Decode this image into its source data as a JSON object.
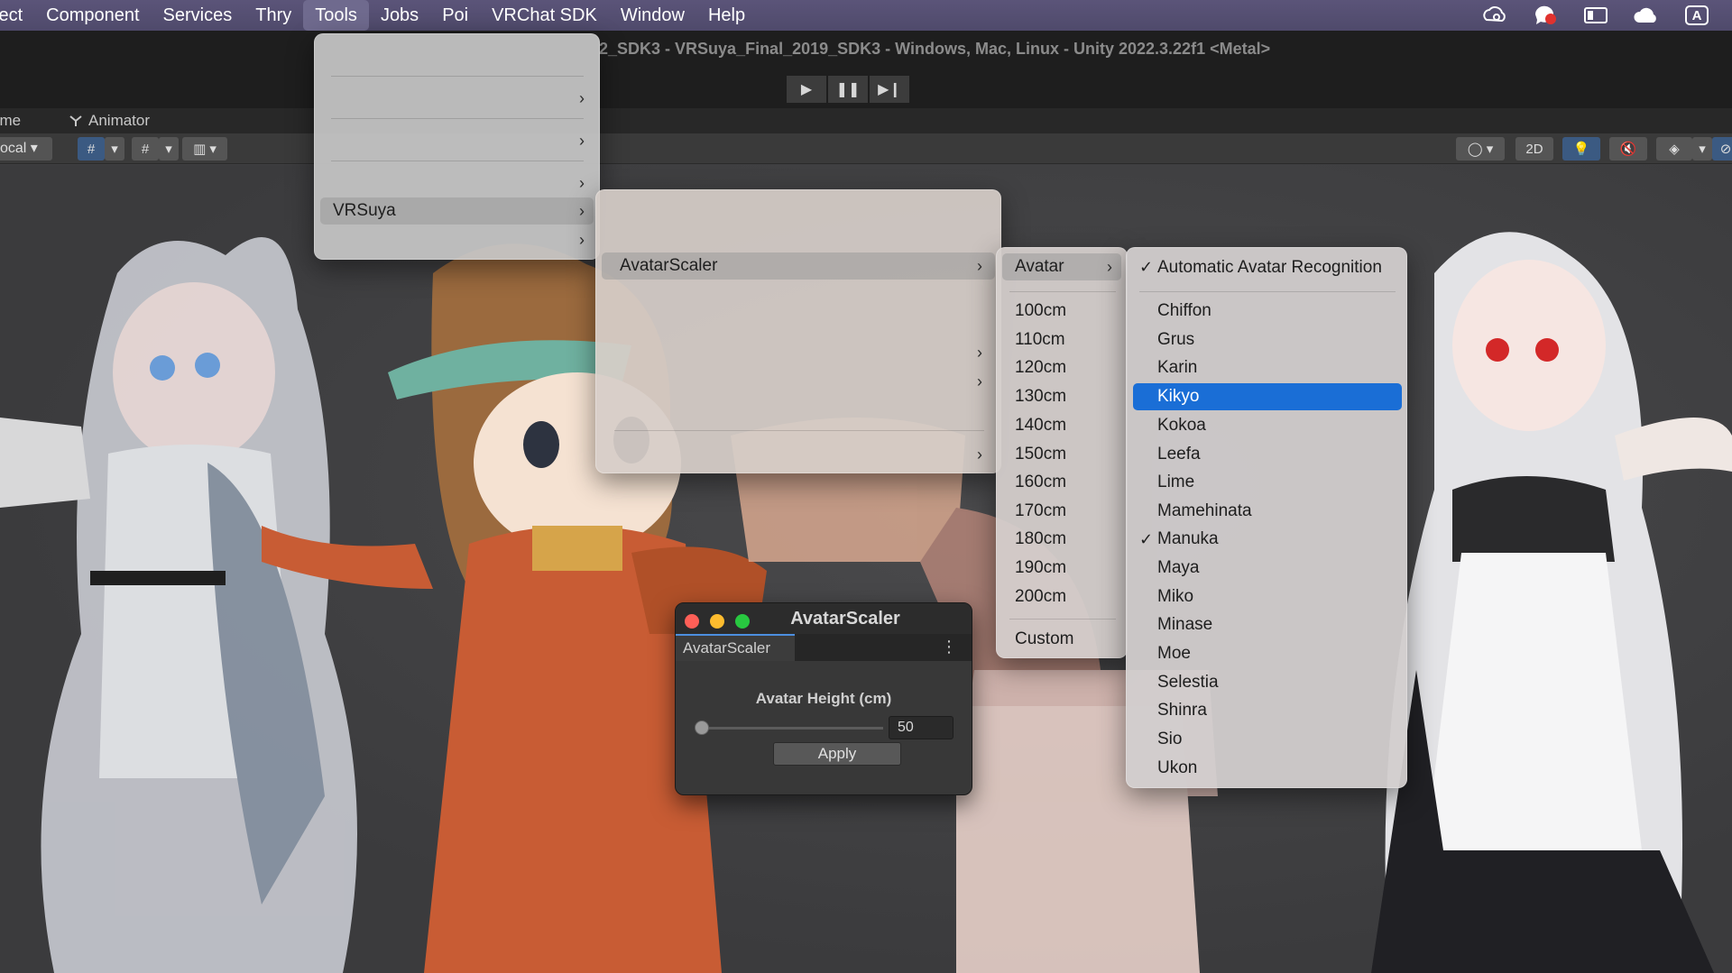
{
  "menubar": {
    "items": [
      "ject",
      "Component",
      "Services",
      "Thry",
      "Tools",
      "Jobs",
      "Poi",
      "VRChat SDK",
      "Window",
      "Help"
    ],
    "active": "Tools",
    "right_icons": [
      "creative-cloud-icon",
      "notification-icon",
      "display-icon",
      "cloud-icon",
      "input-source-icon"
    ],
    "input_source_label": "A"
  },
  "unity": {
    "window_title": "2_SDK3 - VRSuya_Final_2019_SDK3 - Windows, Mac, Linux - Unity 2022.3.22f1 <Metal>",
    "tabs": {
      "game": "ame",
      "animator": "Animator"
    },
    "toolbar": {
      "local": "ocal",
      "mode_2d": "2D"
    }
  },
  "tools_menu": {
    "vrsuya": "VRSuya"
  },
  "vrsuya_menu": {
    "avatar_scaler": "AvatarScaler"
  },
  "avatarscaler_menu": {
    "avatar": "Avatar",
    "heights": [
      "100cm",
      "110cm",
      "120cm",
      "130cm",
      "140cm",
      "150cm",
      "160cm",
      "170cm",
      "180cm",
      "190cm",
      "200cm"
    ],
    "custom": "Custom"
  },
  "avatar_menu": {
    "auto": "Automatic Avatar Recognition",
    "avatars": [
      "Chiffon",
      "Grus",
      "Karin",
      "Kikyo",
      "Kokoa",
      "Leefa",
      "Lime",
      "Mamehinata",
      "Manuka",
      "Maya",
      "Miko",
      "Minase",
      "Moe",
      "Selestia",
      "Shinra",
      "Sio",
      "Ukon"
    ],
    "selected": "Kikyo",
    "checked": [
      "Automatic Avatar Recognition",
      "Manuka"
    ]
  },
  "panel": {
    "title": "AvatarScaler",
    "tab": "AvatarScaler",
    "height_label": "Avatar Height (cm)",
    "height_value": "50",
    "apply": "Apply"
  },
  "colors": {
    "menubar": "#5b5479",
    "selection": "#1a6ed6",
    "traffic_close": "#fe5f57",
    "traffic_min": "#febc2e",
    "traffic_max": "#28c840"
  }
}
